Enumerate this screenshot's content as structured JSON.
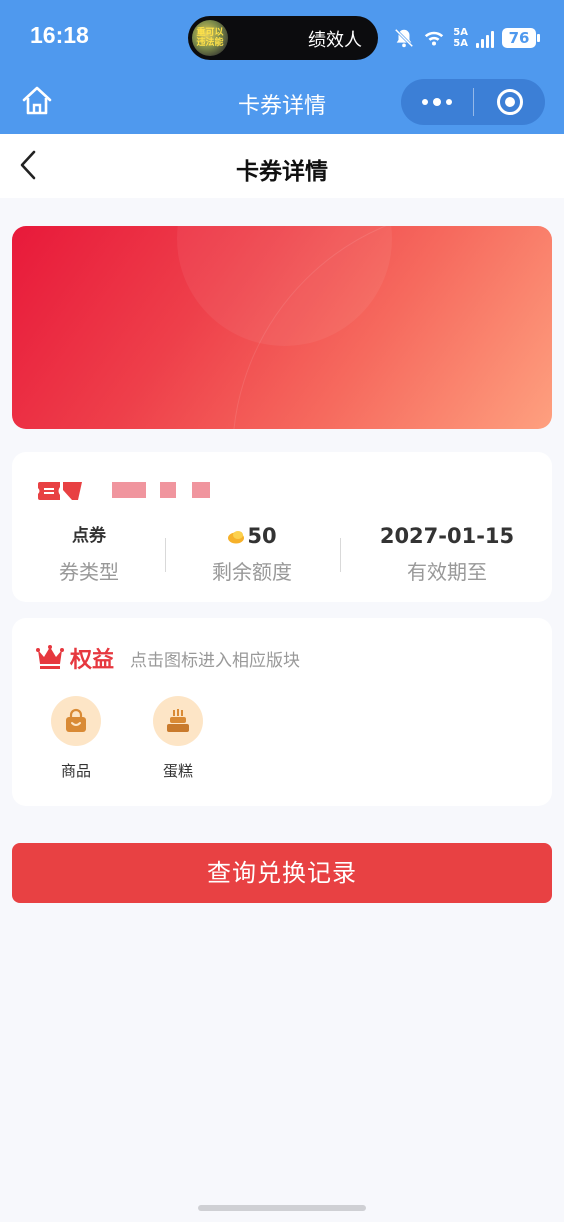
{
  "status_bar": {
    "time": "16:18",
    "island_text": "绩效人",
    "island_thumb_text": "重可以\n违法能",
    "network_top": "5A",
    "network_bottom": "5A",
    "battery": "76"
  },
  "mp_nav": {
    "title": "卡券详情",
    "home_icon": "home-icon",
    "more_icon": "more-dots-icon",
    "close_icon": "target-icon"
  },
  "page_header": {
    "title": "卡券详情",
    "back_icon": "chevron-left-icon"
  },
  "card_info": {
    "stats": [
      {
        "value": "点券",
        "label": "券类型"
      },
      {
        "value": "50",
        "label": "剩余额度",
        "icon": "coin-icon"
      },
      {
        "value": "2027-01-15",
        "label": "有效期至"
      }
    ]
  },
  "benefits": {
    "title": "权益",
    "hint": "点击图标进入相应版块",
    "items": [
      {
        "label": "商品",
        "icon": "shopping-bag-icon"
      },
      {
        "label": "蛋糕",
        "icon": "cake-icon"
      }
    ]
  },
  "query_button": {
    "label": "查询兑换记录"
  },
  "colors": {
    "nav_blue": "#4f99ee",
    "accent_red": "#e84143",
    "banner_start": "#e8193a",
    "banner_end": "#fea07f",
    "benefit_circle": "#fde5c6"
  }
}
